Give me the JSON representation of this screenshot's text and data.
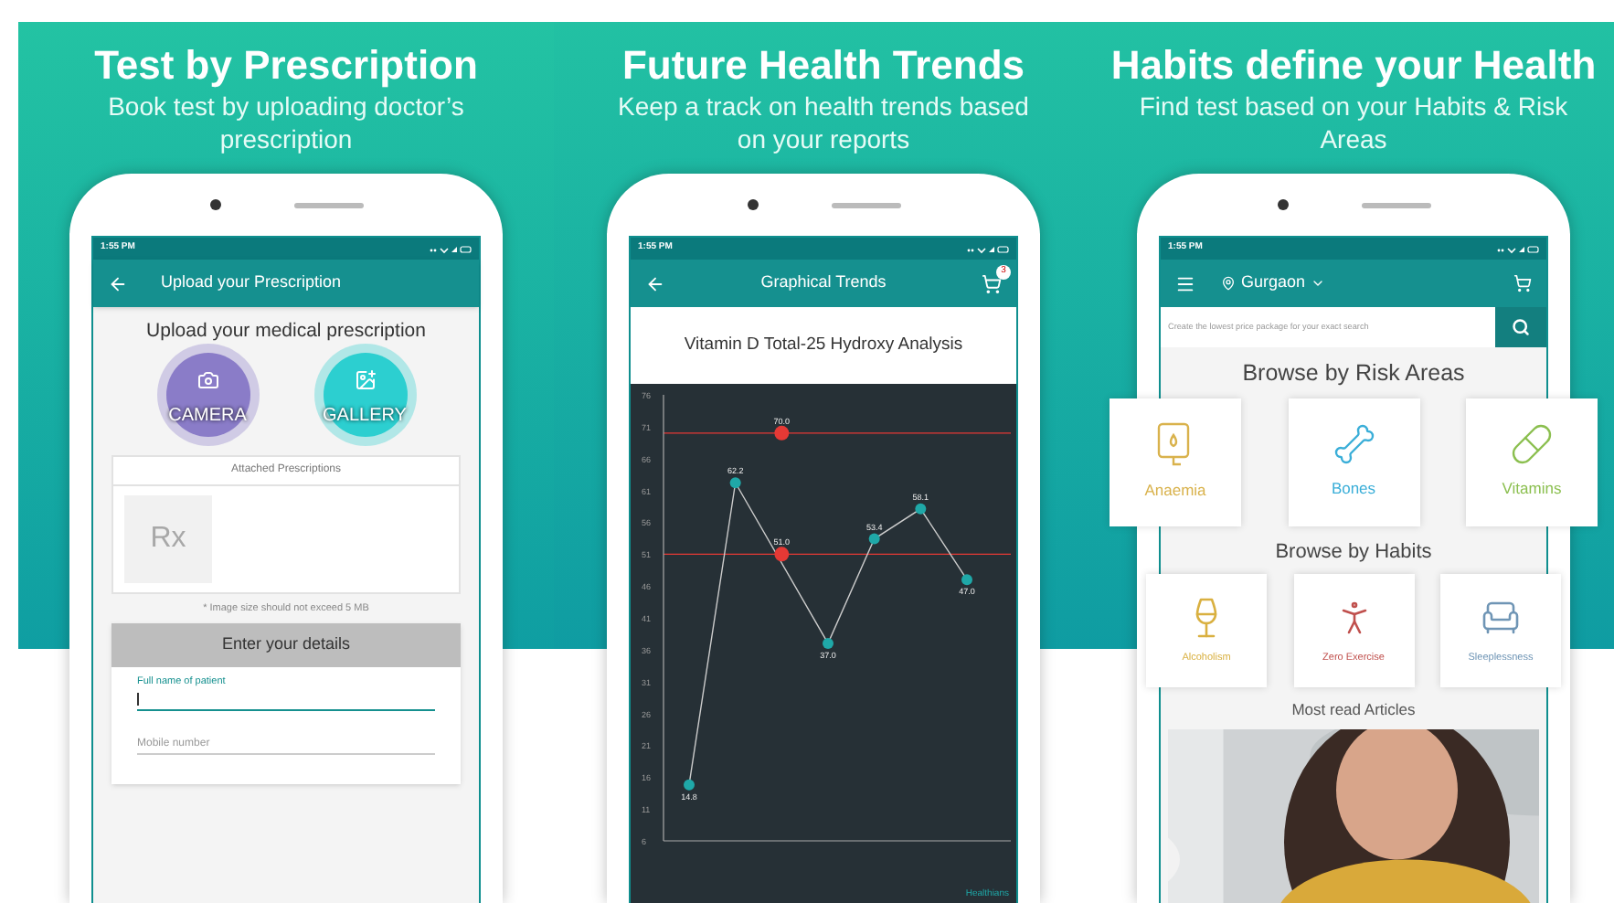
{
  "panels": [
    {
      "title": "Test by Prescription",
      "subtitle": "Book test by uploading doctor’s prescription"
    },
    {
      "title": "Future Health Trends",
      "subtitle": "Keep a track on health trends based on your reports"
    },
    {
      "title": "Habits define your Health",
      "subtitle": "Find test based on your Habits & Risk Areas"
    }
  ],
  "upload_screen": {
    "status_time": "1:55 PM",
    "app_bar_title": "Upload your Prescription",
    "heading": "Upload your medical prescription",
    "sources": [
      {
        "label": "CAMERA",
        "color": "#8a7cc8"
      },
      {
        "label": "GALLERY",
        "color": "#2ccfd0"
      }
    ],
    "attached": {
      "heading": "Attached Prescriptions",
      "placeholder_symbol": "Rx"
    },
    "note": "* Image size should not exceed 5 MB",
    "details": {
      "heading": "Enter your details",
      "fields": [
        {
          "label": "Full name of patient",
          "focused": true
        },
        {
          "placeholder": "Mobile number",
          "focused": false
        }
      ]
    }
  },
  "trends_screen": {
    "status_time": "1:55 PM",
    "app_bar_title": "Graphical Trends",
    "cart_count": "3",
    "test_name": "Vitamin D Total-25 Hydroxy Analysis",
    "watermark_text": "Healthians",
    "chart_data": {
      "type": "line",
      "ylim": [
        6,
        76
      ],
      "yticks": [
        76,
        71,
        66,
        61,
        56,
        51,
        46,
        41,
        36,
        31,
        26,
        21,
        16,
        11,
        6
      ],
      "series": [
        {
          "color": "#1fa8a8",
          "marker": "circle",
          "values": [
            14.8,
            62.2,
            null,
            37.0,
            53.4,
            58.1,
            47.0
          ]
        },
        {
          "color": "#e53935",
          "marker": "circle",
          "values": [
            null,
            null,
            70.0,
            null,
            null,
            null,
            null
          ]
        },
        {
          "color": "#e53935",
          "marker": "circle",
          "values": [
            null,
            null,
            51.0,
            null,
            null,
            null,
            null
          ]
        }
      ],
      "value_labels": [
        [
          "14.8",
          "62.2",
          null,
          "37.0",
          "53.4",
          "58.1",
          "47.0"
        ],
        [
          null,
          null,
          "70.0",
          null,
          null,
          null,
          null
        ],
        [
          null,
          null,
          "51.0",
          null,
          null,
          null,
          null
        ]
      ],
      "ref_lines": [
        {
          "axis": "y",
          "value": 70,
          "color": "#e53935"
        },
        {
          "axis": "y",
          "value": 51,
          "color": "#e53935"
        }
      ]
    }
  },
  "habits_screen": {
    "status_time": "1:55 PM",
    "location": "Gurgaon",
    "search": {
      "placeholder": "Create the lowest price package for your exact search"
    },
    "risk_heading": "Browse by Risk Areas",
    "risk_areas": [
      {
        "label": "Anaemia",
        "color": "#d9b24c"
      },
      {
        "label": "Bones",
        "color": "#3aaed8"
      },
      {
        "label": "Vitamins",
        "color": "#8bbf4f"
      }
    ],
    "habits_heading": "Browse by Habits",
    "habits": [
      {
        "label": "Alcoholism",
        "color": "#d9b040"
      },
      {
        "label": "Zero Exercise",
        "color": "#c0504d"
      },
      {
        "label": "Sleeplessness",
        "color": "#6f95b5"
      }
    ],
    "articles_heading": "Most read Articles"
  }
}
